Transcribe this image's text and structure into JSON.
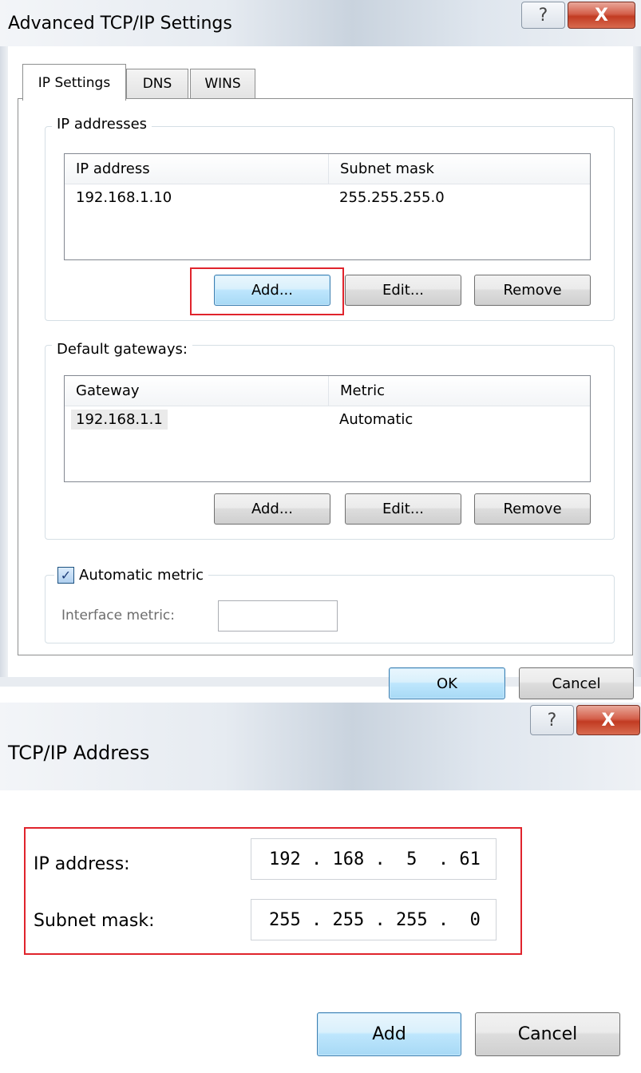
{
  "advanced_dialog": {
    "title": "Advanced TCP/IP Settings",
    "tabs": [
      {
        "label": "IP Settings",
        "active": true
      },
      {
        "label": "DNS",
        "active": false
      },
      {
        "label": "WINS",
        "active": false
      }
    ],
    "ip_addresses": {
      "group_label": "IP addresses",
      "columns": [
        "IP address",
        "Subnet mask"
      ],
      "rows": [
        {
          "ip": "192.168.1.10",
          "mask": "255.255.255.0"
        }
      ],
      "buttons": {
        "add": "Add...",
        "edit": "Edit...",
        "remove": "Remove"
      }
    },
    "default_gateways": {
      "group_label": "Default gateways:",
      "columns": [
        "Gateway",
        "Metric"
      ],
      "rows": [
        {
          "gateway": "192.168.1.1",
          "metric": "Automatic"
        }
      ],
      "buttons": {
        "add": "Add...",
        "edit": "Edit...",
        "remove": "Remove"
      }
    },
    "automatic_metric": {
      "label": "Automatic metric",
      "checked": true,
      "interface_metric_label": "Interface metric:",
      "interface_metric_value": ""
    },
    "footer": {
      "ok": "OK",
      "cancel": "Cancel"
    }
  },
  "tcpip_dialog": {
    "title": "TCP/IP Address",
    "ip_label": "IP address:",
    "ip_value": "192 . 168 .  5  . 61",
    "mask_label": "Subnet mask:",
    "mask_value": "255 . 255 . 255 .  0",
    "buttons": {
      "add": "Add",
      "cancel": "Cancel"
    }
  },
  "icons": {
    "help": "?",
    "close": "X",
    "check": "✓"
  },
  "colors": {
    "highlight_red": "#e0242c",
    "default_button_blue": "#3c7fb1",
    "close_red": "#c23b22"
  }
}
